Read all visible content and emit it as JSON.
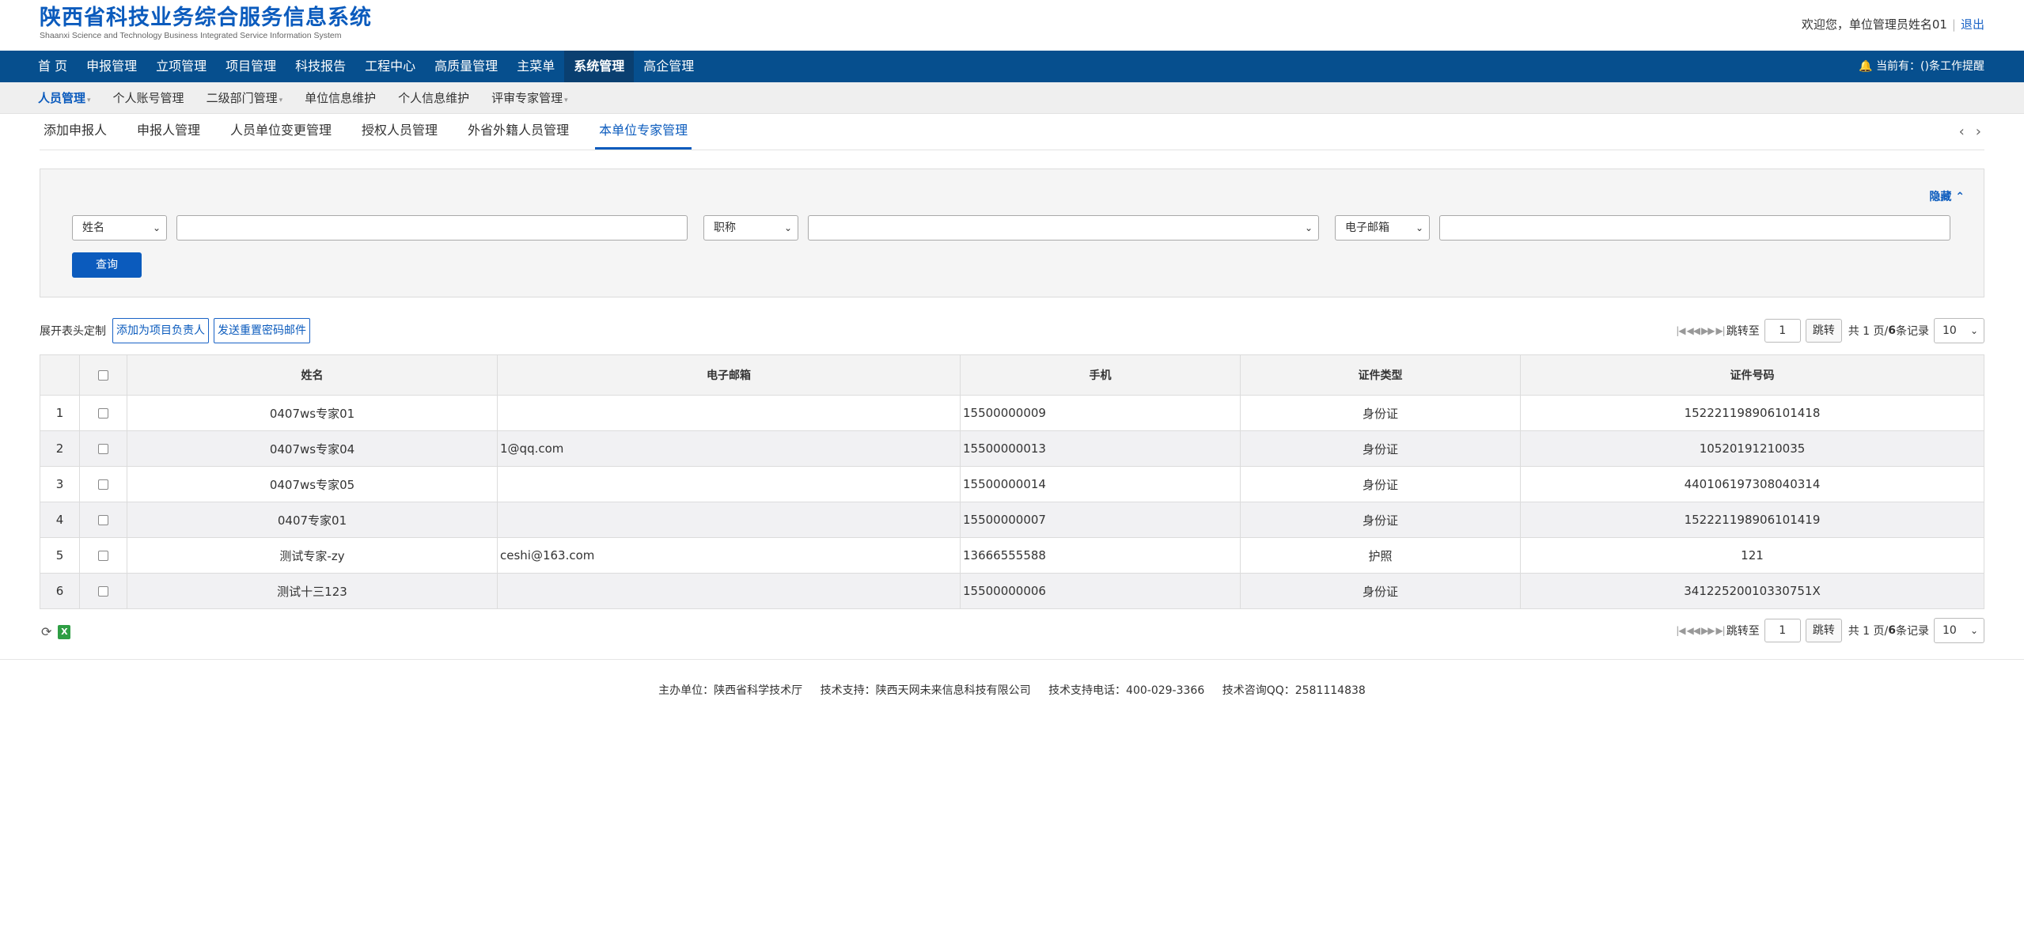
{
  "header": {
    "title_cn": "陕西省科技业务综合服务信息系统",
    "title_en": "Shaanxi Science and Technology Business Integrated Service Information System",
    "welcome": "欢迎您，单位管理员姓名01",
    "separator": "|",
    "logout": "退出"
  },
  "main_nav": {
    "items": [
      "首 页",
      "申报管理",
      "立项管理",
      "项目管理",
      "科技报告",
      "工程中心",
      "高质量管理",
      "主菜单",
      "系统管理",
      "高企管理"
    ],
    "active": "系统管理",
    "reminder_prefix": "当前有：(",
    "reminder_count": "",
    "reminder_suffix": ")条工作提醒"
  },
  "sub_nav": {
    "items": [
      "人员管理",
      "个人账号管理",
      "二级部门管理",
      "单位信息维护",
      "个人信息维护",
      "评审专家管理"
    ],
    "active": "人员管理"
  },
  "tabs": {
    "items": [
      "添加申报人",
      "申报人管理",
      "人员单位变更管理",
      "授权人员管理",
      "外省外籍人员管理",
      "本单位专家管理"
    ],
    "active": "本单位专家管理"
  },
  "search": {
    "hide_label": "隐藏",
    "field1_select": "姓名",
    "field2_select": "职称",
    "field3_select": "电子邮箱",
    "query_button": "查询"
  },
  "toolbar": {
    "customize_label": "展开表头定制",
    "add_leader_button": "添加为项目负责人",
    "reset_pwd_button": "发送重置密码邮件"
  },
  "pager": {
    "jump_to": "跳转至",
    "page_input": "1",
    "jump_button": "跳转",
    "total_prefix": "共 1 页/",
    "total_records": "6",
    "total_suffix": " 条记录",
    "page_size": "10"
  },
  "table": {
    "columns": [
      "姓名",
      "电子邮箱",
      "手机",
      "证件类型",
      "证件号码"
    ],
    "rows": [
      {
        "no": "1",
        "name": "0407ws专家01",
        "email": "",
        "phone": "15500000009",
        "id_type": "身份证",
        "id_no": "152221198906101418"
      },
      {
        "no": "2",
        "name": "0407ws专家04",
        "email": "1@qq.com",
        "phone": "15500000013",
        "id_type": "身份证",
        "id_no": "10520191210035"
      },
      {
        "no": "3",
        "name": "0407ws专家05",
        "email": "",
        "phone": "15500000014",
        "id_type": "身份证",
        "id_no": "440106197308040314"
      },
      {
        "no": "4",
        "name": "0407专家01",
        "email": "",
        "phone": "15500000007",
        "id_type": "身份证",
        "id_no": "152221198906101419"
      },
      {
        "no": "5",
        "name": "测试专家-zy",
        "email": "ceshi@163.com",
        "phone": "13666555588",
        "id_type": "护照",
        "id_no": "121"
      },
      {
        "no": "6",
        "name": "测试十三123",
        "email": "",
        "phone": "15500000006",
        "id_type": "身份证",
        "id_no": "34122520010330751X"
      }
    ]
  },
  "footer": {
    "host": "主办单位：陕西省科学技术厅",
    "support": "技术支持：陕西天网未来信息科技有限公司",
    "phone": "技术支持电话：400-029-3366",
    "qq": "技术咨询QQ：2581114838"
  }
}
